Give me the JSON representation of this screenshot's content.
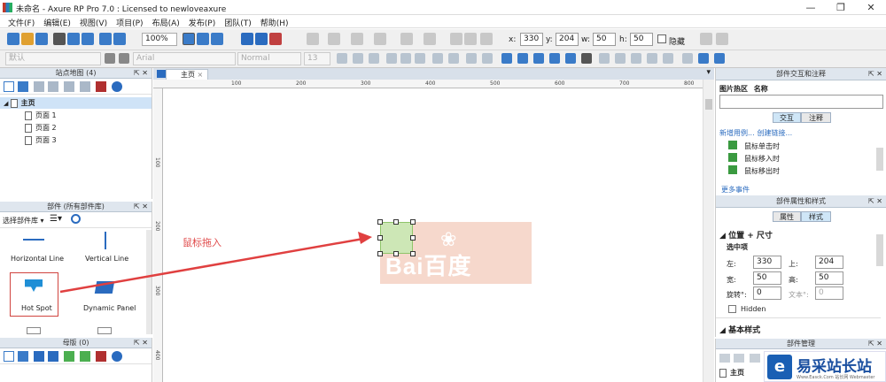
{
  "window": {
    "title": "未命名 - Axure RP Pro 7.0 : Licensed to newloveaxure",
    "min": "—",
    "max": "❐",
    "close": "✕"
  },
  "menu": [
    "文件(F)",
    "编辑(E)",
    "视图(V)",
    "项目(P)",
    "布局(A)",
    "发布(P)",
    "团队(T)",
    "帮助(H)"
  ],
  "toolbar": {
    "zoom": "100%",
    "x_label": "x:",
    "x": "330",
    "y_label": "y:",
    "y": "204",
    "w_label": "w:",
    "w": "50",
    "h_label": "h:",
    "h": "50",
    "hidden_label": "隐藏"
  },
  "toolbar2": {
    "style": "默认",
    "font": "Arial",
    "weight": "Normal",
    "size": "13"
  },
  "sitemap": {
    "title": "站点地图 (4)",
    "root": "主页",
    "pages": [
      "页面 1",
      "页面 2",
      "页面 3"
    ]
  },
  "widgets": {
    "title": "部件 (所有部件库)",
    "library": "选择部件库",
    "items": [
      "Horizontal Line",
      "Vertical Line",
      "Hot Spot",
      "Dynamic Panel"
    ]
  },
  "masters": {
    "title": "母版 (0)"
  },
  "canvas": {
    "tab": "主页",
    "h_ticks": [
      "100",
      "200",
      "300",
      "400",
      "500",
      "600",
      "700",
      "800"
    ],
    "v_ticks": [
      "100",
      "200",
      "300",
      "400"
    ],
    "annotation": "鼠标拖入",
    "logo_text": "Bai百度"
  },
  "interactions": {
    "title": "部件交互和注释",
    "label": "图片热区",
    "name_label": "名称",
    "tab_interaction": "交互",
    "tab_notes": "注释",
    "new_case": "新增用例...",
    "create_link": "创建链接...",
    "events": [
      "鼠标单击时",
      "鼠标移入时",
      "鼠标移出时"
    ],
    "more": "更多事件"
  },
  "properties": {
    "title": "部件属性和样式",
    "tab_props": "属性",
    "tab_style": "样式",
    "section": "位置 + 尺寸",
    "selected": "选中项",
    "left_label": "左:",
    "left": "330",
    "top_label": "上:",
    "top": "204",
    "width_label": "宽:",
    "width": "50",
    "height_label": "高:",
    "height": "50",
    "rotate_label": "旋转°:",
    "rotate": "0",
    "text_label": "文本°:",
    "text": "0",
    "hidden": "Hidden",
    "basic_style": "基本样式"
  },
  "widget_manager": {
    "title": "部件管理",
    "root": "主页"
  },
  "watermark": {
    "text": "易采站长站",
    "sub": "Www.Easck.Com 站长网 Webmaster"
  }
}
